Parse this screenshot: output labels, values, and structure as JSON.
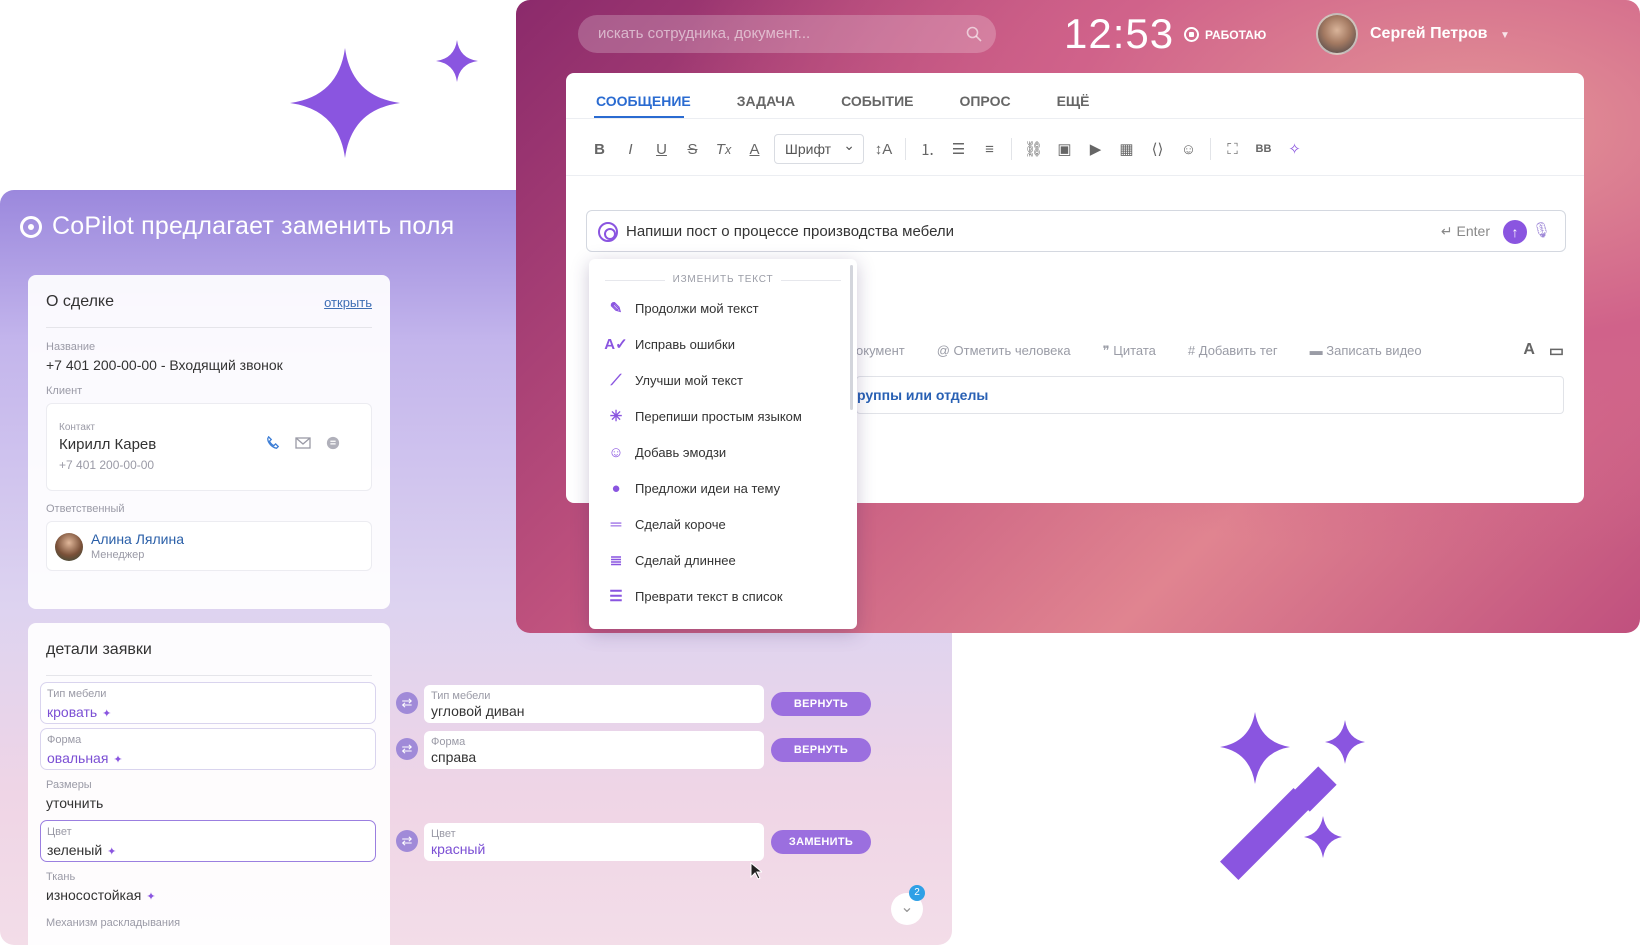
{
  "copilot": {
    "title": "CoPilot предлагает заменить поля",
    "deal": {
      "heading": "О сделке",
      "open_link": "открыть",
      "name_label": "Название",
      "name_value": "+7 401 200-00-00 - Входящий звонок",
      "client_label": "Клиент",
      "contact_label": "Контакт",
      "contact_name": "Кирилл Карев",
      "contact_phone": "+7 401 200-00-00",
      "responsible_label": "Ответственный",
      "responsible_name": "Алина Лялина",
      "responsible_role": "Менеджер"
    },
    "details": {
      "heading": "детали заявки",
      "fields": [
        {
          "label": "Тип мебели",
          "value": "кровать"
        },
        {
          "label": "Форма",
          "value": "овальная"
        },
        {
          "label": "Размеры",
          "value": "уточнить"
        },
        {
          "label": "Цвет",
          "value": "зеленый"
        },
        {
          "label": "Ткань",
          "value": "износостойкая"
        },
        {
          "label": "Механизм раскладывания",
          "value": ""
        }
      ],
      "suggestions": [
        {
          "label": "Тип мебели",
          "value": "угловой диван",
          "button": "ВЕРНУТЬ"
        },
        {
          "label": "Форма",
          "value": "справа",
          "button": "ВЕРНУТЬ"
        },
        {
          "label": "Цвет",
          "value": "красный",
          "button": "ЗАМЕНИТЬ"
        }
      ],
      "badge_count": "2"
    }
  },
  "header": {
    "search_placeholder": "искать сотрудника, документ...",
    "clock": "12:53",
    "status": "РАБОТАЮ",
    "user_name": "Сергей Петров"
  },
  "editor": {
    "tabs": [
      "СООБЩЕНИЕ",
      "ЗАДАЧА",
      "СОБЫТИЕ",
      "ОПРОС",
      "ЕЩЁ"
    ],
    "active_tab": "СООБЩЕНИЕ",
    "font_select": "Шрифт",
    "prompt_text": "Напиши пост о процессе производства мебели",
    "enter_hint": "Enter",
    "bottom_actions": [
      "окумент",
      "Отметить человека",
      "Цитата",
      "Добавить тег",
      "Записать видео"
    ],
    "recipients_text": "руппы или отделы",
    "menu": {
      "heading": "ИЗМЕНИТЬ ТЕКСТ",
      "items": [
        {
          "label": "Продолжи мой текст",
          "icon": "pen-line-icon"
        },
        {
          "label": "Исправь ошибки",
          "icon": "spellcheck-icon"
        },
        {
          "label": "Улучши мой текст",
          "icon": "magic-wand-icon"
        },
        {
          "label": "Перепиши простым языком",
          "icon": "sparkle-burst-icon"
        },
        {
          "label": "Добавь эмодзи",
          "icon": "emoji-icon"
        },
        {
          "label": "Предложи идеи на тему",
          "icon": "lightbulb-icon"
        },
        {
          "label": "Сделай короче",
          "icon": "short-lines-icon"
        },
        {
          "label": "Сделай длиннее",
          "icon": "long-lines-icon"
        },
        {
          "label": "Преврати текст в список",
          "icon": "list-icon"
        }
      ]
    }
  },
  "colors": {
    "accent": "#8a55e0",
    "link": "#2a6bd1",
    "button": "#9b6fdf"
  }
}
